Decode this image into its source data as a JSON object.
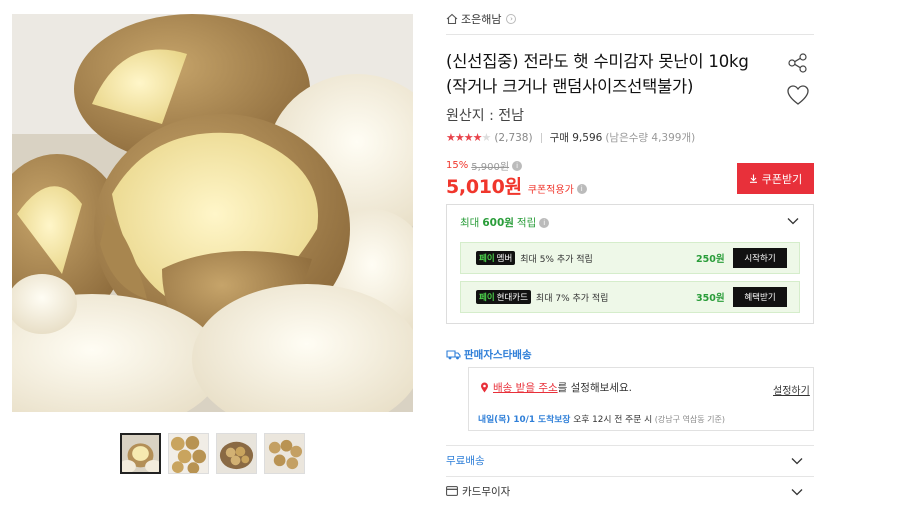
{
  "store": {
    "name": "조은해남",
    "home_icon": "home-icon",
    "chevron_icon": "chevron-right-icon"
  },
  "product": {
    "title_line1": "(신선집중) 전라도 햇 수미감자 못난이 10kg",
    "title_line2": "(작거나 크거나 랜덤사이즈선택불가)",
    "origin": "원산지 : 전남"
  },
  "rating": {
    "stars": 4,
    "stars_max": 5,
    "review_count": "(2,738)",
    "purchase": "구매 9,596",
    "remaining": "(남은수량 4,399개)"
  },
  "price": {
    "discount_rate": "15%",
    "original": "5,900원",
    "final": "5,010원",
    "coupon_note": "쿠폰적용가",
    "coupon_button": "쿠폰받기",
    "accent_color": "#e8303a"
  },
  "reward": {
    "header_prefix": "최대 ",
    "header_amount": "600원",
    "header_suffix": " 적립",
    "items": [
      {
        "badge_tag": "페이",
        "badge_label": "멤버",
        "text": "최대 5% 추가 적립",
        "amount": "250원",
        "button": "시작하기"
      },
      {
        "badge_tag": "페이",
        "badge_label": "현대카드",
        "text": "최대 7% 추가 적립",
        "amount": "350원",
        "button": "혜택받기"
      }
    ]
  },
  "shipping": {
    "seller_label": "판매자스타배송",
    "address_link": "배송 받을 주소",
    "address_suffix": "를 설정해보세요.",
    "address_setting": "설정하기",
    "eta_date": "내일(목) 10/1 도착보장",
    "eta_cutoff": " 오후 12시 전 주문 시",
    "eta_note": " (강남구 역삼동 기준)"
  },
  "accordion": [
    {
      "label": "무료배송"
    },
    {
      "label": "카드무이자"
    }
  ],
  "gallery": {
    "thumbnail_count": 4,
    "active_index": 0
  }
}
